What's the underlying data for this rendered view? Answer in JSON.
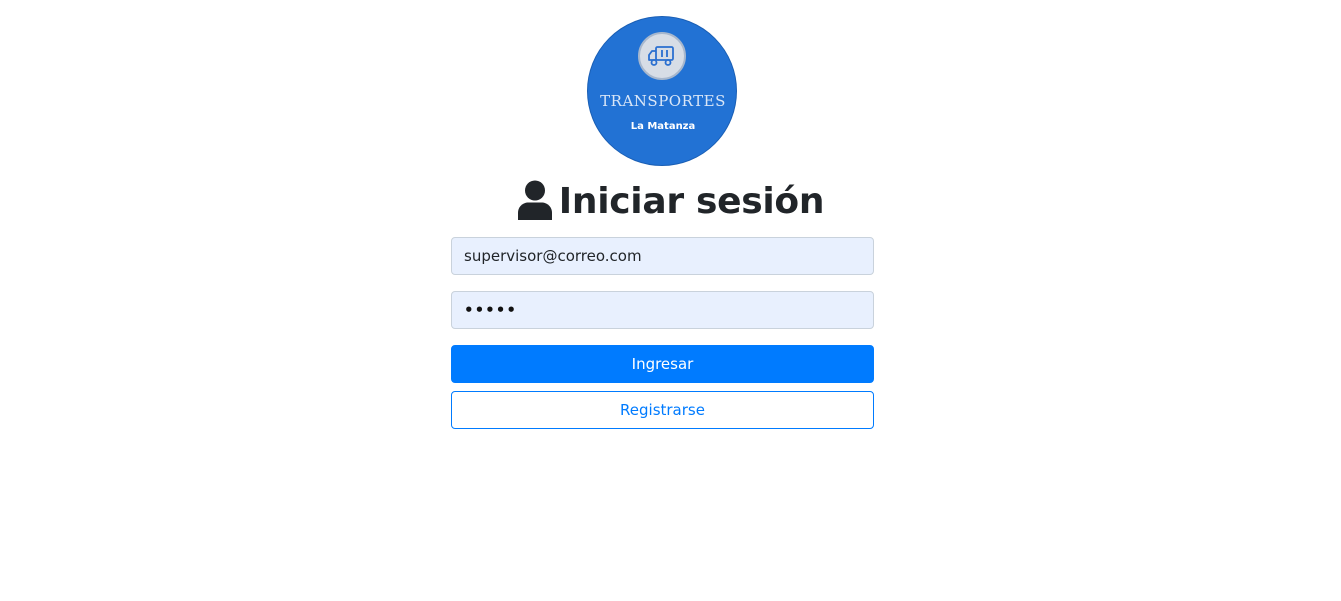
{
  "logo": {
    "title": "TRANSPORTES",
    "subtitle": "La Matanza",
    "icon": "truck-icon",
    "background_color": "#2272d4"
  },
  "login": {
    "heading": "Iniciar sesión",
    "heading_icon": "user-icon",
    "email_value": "supervisor@correo.com",
    "password_value": "•••••",
    "submit_label": "Ingresar",
    "register_label": "Registrarse"
  },
  "colors": {
    "primary": "#007bff",
    "input_autofill": "#e8f0fe",
    "heading_text": "#212529"
  }
}
